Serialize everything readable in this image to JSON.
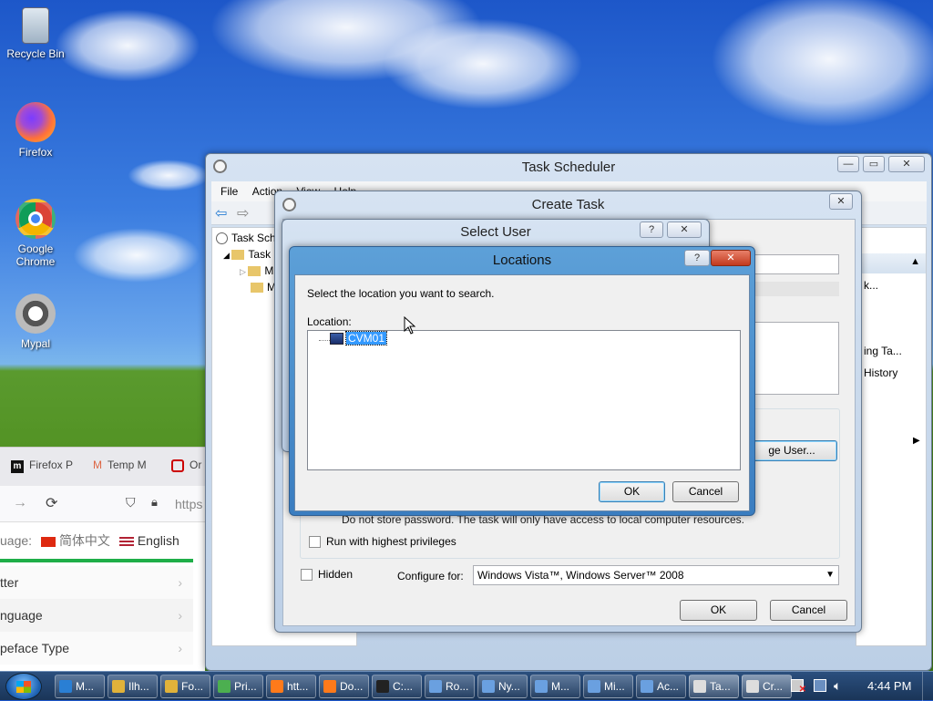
{
  "desktop": {
    "icons": [
      {
        "label": "Recycle Bin",
        "icon": "recycle-bin-icon"
      },
      {
        "label": "Firefox",
        "icon": "firefox-icon"
      },
      {
        "label": "Google Chrome",
        "icon": "chrome-icon"
      },
      {
        "label": "Mypal",
        "icon": "mypal-icon"
      }
    ]
  },
  "browser": {
    "tabs": [
      "Firefox P",
      "Temp M",
      "Or"
    ],
    "url_partial": "https",
    "language_label": "uage:",
    "lang_cn": "简体中文",
    "lang_en": "English",
    "menu": [
      "tter",
      "nguage",
      "peface Type"
    ]
  },
  "task_scheduler": {
    "title": "Task Scheduler",
    "menu": [
      "File",
      "Action",
      "View",
      "Help"
    ],
    "tree": [
      "Task Sch",
      "Task",
      "M",
      "M"
    ],
    "right_items": [
      "k...",
      "ing Ta...",
      "History"
    ]
  },
  "create_task": {
    "title": "Create Task",
    "change_user_label": "ge User...",
    "password_note": "Do not store password.  The task will only have access to local computer resources.",
    "run_highest": "Run with highest privileges",
    "hidden": "Hidden",
    "configure_for_label": "Configure for:",
    "configure_for_value": "Windows Vista™, Windows Server™ 2008",
    "ok": "OK",
    "cancel": "Cancel"
  },
  "select_user": {
    "title": "Select User",
    "help": "?",
    "close": "✕"
  },
  "locations": {
    "title": "Locations",
    "help": "?",
    "close": "✕",
    "instruction": "Select the location you want to search.",
    "location_label": "Location:",
    "tree_item": "CVM01",
    "ok": "OK",
    "cancel": "Cancel"
  },
  "taskbar": {
    "items": [
      {
        "label": "M...",
        "color": "#2a7fd4"
      },
      {
        "label": "Ilh...",
        "color": "#e0b23a"
      },
      {
        "label": "Fo...",
        "color": "#e0b23a"
      },
      {
        "label": "Pri...",
        "color": "#4caf50"
      },
      {
        "label": "htt...",
        "color": "#ff7a1a"
      },
      {
        "label": "Do...",
        "color": "#ff7a1a"
      },
      {
        "label": "C:...",
        "color": "#222"
      },
      {
        "label": "Ro...",
        "color": "#6aa0e0"
      },
      {
        "label": "Ny...",
        "color": "#6aa0e0"
      },
      {
        "label": "M...",
        "color": "#6aa0e0"
      },
      {
        "label": "Mi...",
        "color": "#6aa0e0"
      },
      {
        "label": "Ac...",
        "color": "#6aa0e0"
      },
      {
        "label": "Ta...",
        "color": "#ddd"
      },
      {
        "label": "Cr...",
        "color": "#ddd"
      }
    ],
    "clock": "4:44 PM"
  }
}
